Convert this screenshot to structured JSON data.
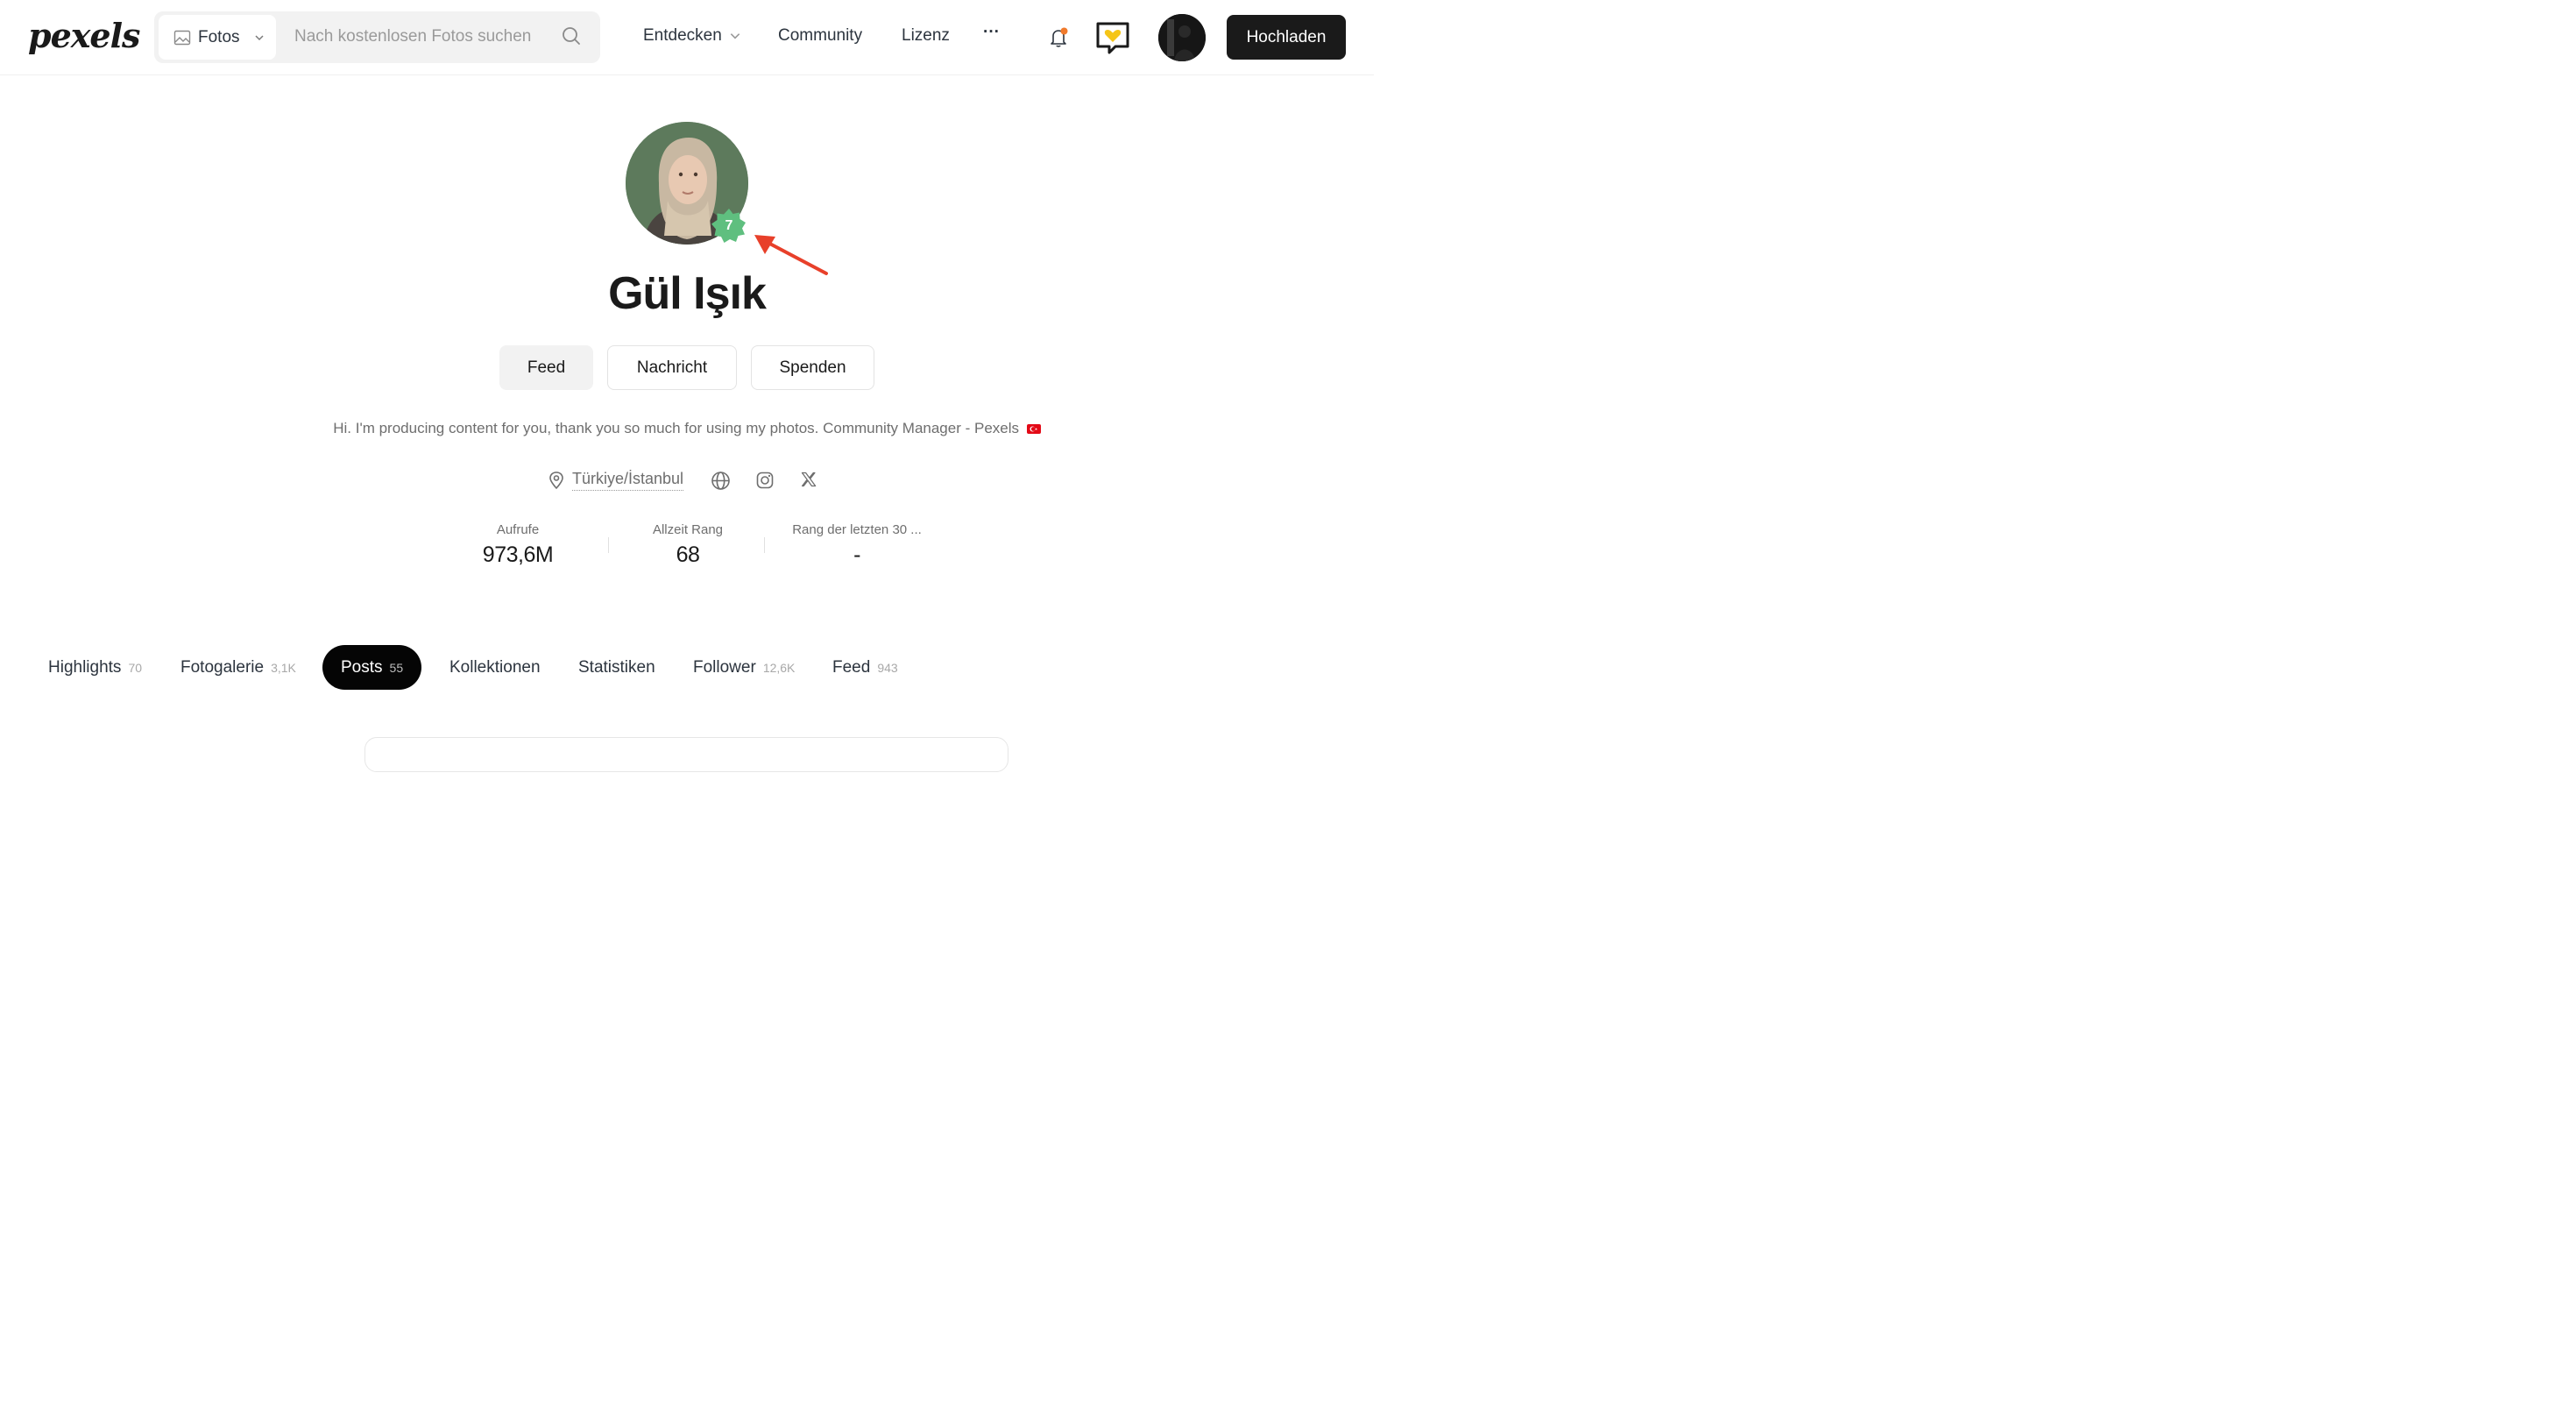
{
  "header": {
    "logo": "pexels",
    "search": {
      "type_label": "Fotos",
      "placeholder": "Nach kostenlosen Fotos suchen"
    },
    "nav": {
      "explore": "Entdecken",
      "community": "Community",
      "license": "Lizenz",
      "more": "···"
    },
    "upload_label": "Hochladen"
  },
  "profile": {
    "name": "Gül Işık",
    "level_badge": "7",
    "buttons": {
      "feed": "Feed",
      "message": "Nachricht",
      "donate": "Spenden"
    },
    "bio": "Hi. I'm producing content for you, thank you so much for using my photos. Community Manager - Pexels",
    "location": "Türkiye/İstanbul",
    "stats": [
      {
        "label": "Aufrufe",
        "value": "973,6M"
      },
      {
        "label": "Allzeit Rang",
        "value": "68"
      },
      {
        "label": "Rang der letzten 30 ...",
        "value": "-"
      }
    ]
  },
  "tabs": [
    {
      "label": "Highlights",
      "count": "70"
    },
    {
      "label": "Fotogalerie",
      "count": "3,1K"
    },
    {
      "label": "Posts",
      "count": "55"
    },
    {
      "label": "Kollektionen",
      "count": ""
    },
    {
      "label": "Statistiken",
      "count": ""
    },
    {
      "label": "Follower",
      "count": "12,6K"
    },
    {
      "label": "Feed",
      "count": "943"
    }
  ],
  "colors": {
    "accent_dark": "#1a1a1a",
    "badge_green": "#5fbf7f",
    "annotation_arrow": "#e8402a",
    "notification_dot": "#f07a2c",
    "heart_yellow": "#f5c518"
  },
  "icons": {
    "type_select": "image-icon",
    "search": "search-icon",
    "notifications": "bell-icon",
    "chat": "heart-speech-bubble-icon",
    "location": "map-pin-icon",
    "website": "globe-icon",
    "instagram": "instagram-icon",
    "x": "x-twitter-icon"
  }
}
